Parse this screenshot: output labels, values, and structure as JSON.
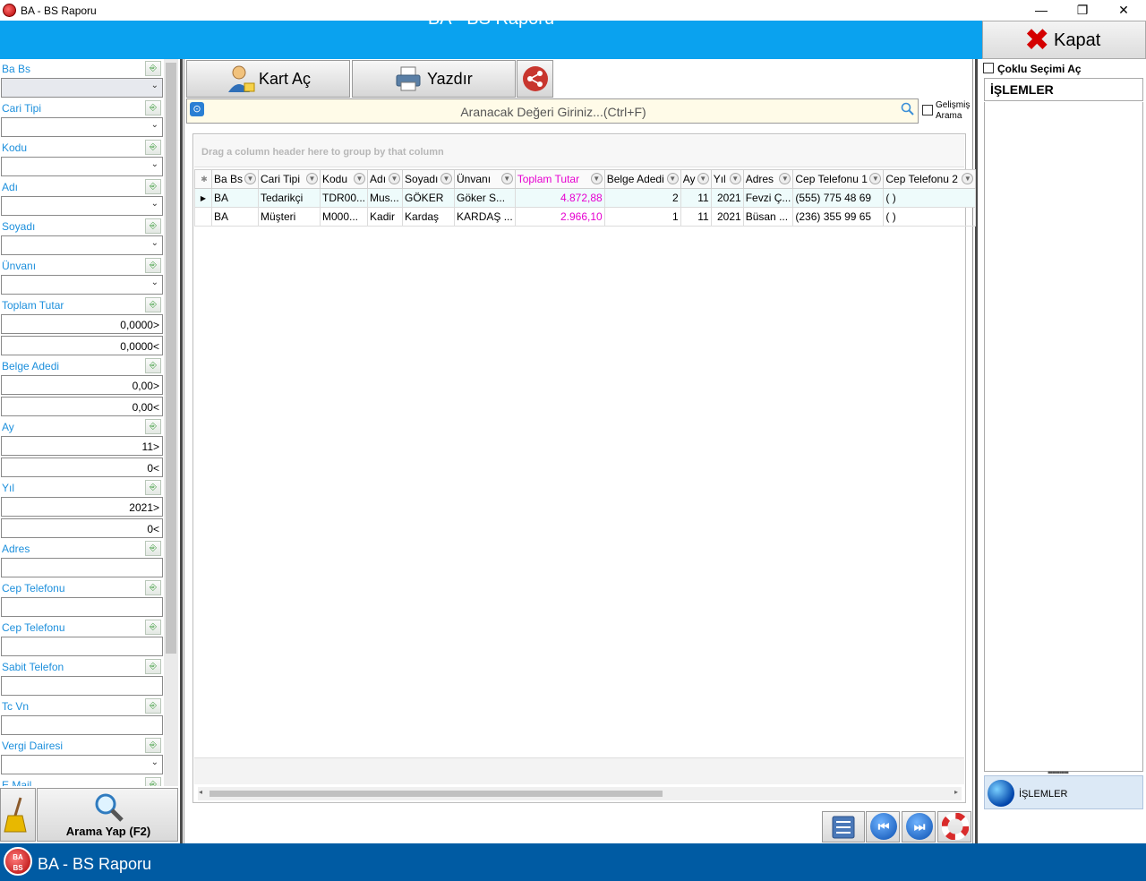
{
  "window": {
    "title": "BA - BS Raporu",
    "controls": {
      "minimize": "—",
      "restore": "❐",
      "close": "✕"
    }
  },
  "header": {
    "title": "BA - BS Raporu",
    "close_label": "Kapat"
  },
  "filters": [
    {
      "label": "Ba Bs",
      "type": "select",
      "values": [
        ""
      ]
    },
    {
      "label": "Cari Tipi",
      "type": "select",
      "values": [
        ""
      ]
    },
    {
      "label": "Kodu",
      "type": "select",
      "values": [
        ""
      ]
    },
    {
      "label": "Adı",
      "type": "select",
      "values": [
        ""
      ]
    },
    {
      "label": "Soyadı",
      "type": "select",
      "values": [
        ""
      ]
    },
    {
      "label": "Ünvanı",
      "type": "select",
      "values": [
        ""
      ]
    },
    {
      "label": "Toplam Tutar",
      "type": "range",
      "values": [
        "0,0000>",
        "0,0000<"
      ]
    },
    {
      "label": "Belge Adedi",
      "type": "range",
      "values": [
        "0,00>",
        "0,00<"
      ]
    },
    {
      "label": "Ay",
      "type": "range",
      "values": [
        "11>",
        "0<"
      ]
    },
    {
      "label": "Yıl",
      "type": "range",
      "values": [
        "2021>",
        "0<"
      ]
    },
    {
      "label": "Adres",
      "type": "text",
      "values": [
        ""
      ]
    },
    {
      "label": "Cep Telefonu",
      "type": "text",
      "values": [
        ""
      ]
    },
    {
      "label": "Cep Telefonu",
      "type": "text",
      "values": [
        ""
      ]
    },
    {
      "label": "Sabit Telefon",
      "type": "text",
      "values": [
        ""
      ]
    },
    {
      "label": "Tc Vn",
      "type": "text",
      "values": [
        ""
      ]
    },
    {
      "label": "Vergi Dairesi",
      "type": "select",
      "values": [
        ""
      ]
    },
    {
      "label": "E Mail",
      "type": "text",
      "values": [
        ""
      ]
    }
  ],
  "left_actions": {
    "search_label": "Arama Yap (F2)"
  },
  "toolbar": {
    "open_card": "Kart Aç",
    "print": "Yazdır"
  },
  "search": {
    "placeholder": "Aranacak Değeri Giriniz...(Ctrl+F)",
    "advanced_label_1": "Gelişmiş",
    "advanced_label_2": "Arama"
  },
  "grid": {
    "group_hint": "Drag a column header here to group by that column",
    "columns": [
      "Ba Bs",
      "Cari Tipi",
      "Kodu",
      "Adı",
      "Soyadı",
      "Ünvanı",
      "Toplam Tutar",
      "Belge Adedi",
      "Ay",
      "Yıl",
      "Adres",
      "Cep Telefonu 1",
      "Cep Telefonu 2"
    ],
    "rows": [
      [
        "BA",
        "Tedarikçi",
        "TDR00...",
        "Mus...",
        "GÖKER",
        "Göker S...",
        "4.872,88",
        "2",
        "11",
        "2021",
        "Fevzi Ç...",
        "(555) 775 48 69",
        "(   )"
      ],
      [
        "BA",
        "Müşteri",
        "M000...",
        "Kadir",
        "Kardaş",
        "KARDAŞ ...",
        "2.966,10",
        "1",
        "11",
        "2021",
        "Büsan ...",
        "(236) 355 99 65",
        "(   )"
      ]
    ]
  },
  "right_panel": {
    "multi_select_label": "Çoklu Seçimi Aç",
    "section_title": "İŞLEMLER",
    "footer_item": "İŞLEMLER"
  },
  "taskbar": {
    "title": "BA - BS Raporu",
    "icon_text_1": "BA",
    "icon_text_2": "BS"
  }
}
